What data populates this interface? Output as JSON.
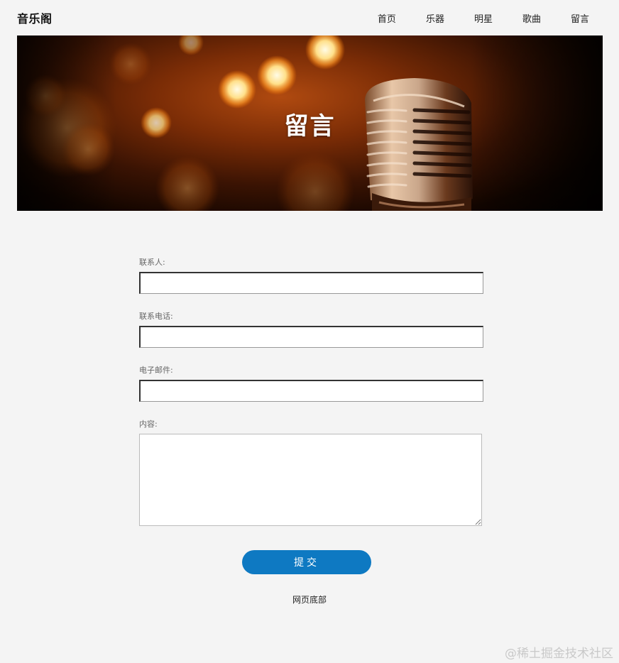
{
  "header": {
    "logo": "音乐阁",
    "nav": [
      {
        "label": "首页"
      },
      {
        "label": "乐器"
      },
      {
        "label": "明星"
      },
      {
        "label": "歌曲"
      },
      {
        "label": "留言"
      }
    ]
  },
  "banner": {
    "title": "留言"
  },
  "form": {
    "contact_label": "联系人:",
    "contact_value": "",
    "phone_label": "联系电话:",
    "phone_value": "",
    "email_label": "电子邮件:",
    "email_value": "",
    "content_label": "内容:",
    "content_value": "",
    "submit_label": "提交"
  },
  "footer": {
    "text": "网页底部"
  },
  "watermark": "@稀土掘金技术社区",
  "colors": {
    "background": "#f4f4f4",
    "accent": "#0e79c2",
    "banner_glow": "#b04a10"
  }
}
